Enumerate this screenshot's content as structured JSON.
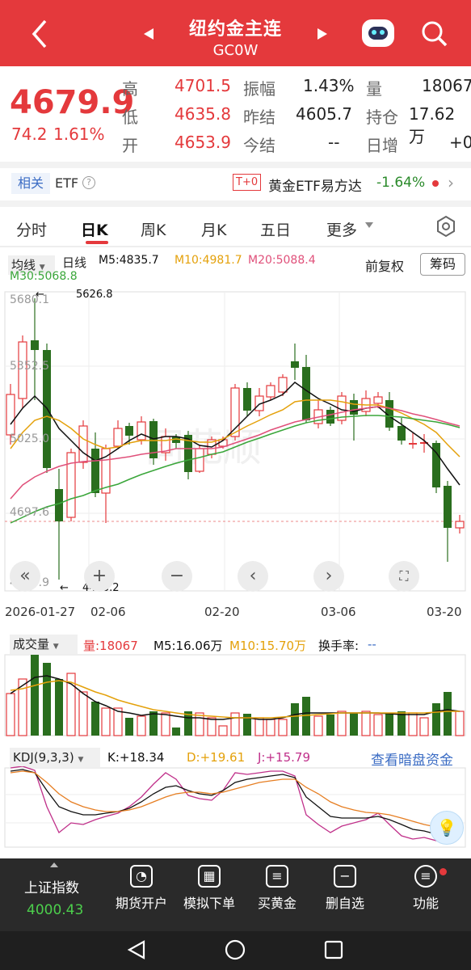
{
  "header": {
    "title": "纽约金主连",
    "code": "GC0W"
  },
  "quote": {
    "price": "4679.9",
    "change": "74.2",
    "change_pct": "1.61%",
    "high_label": "高",
    "high": "4701.5",
    "low_label": "低",
    "low": "4635.8",
    "open_label": "开",
    "open": "4653.9",
    "amp_label": "振幅",
    "amp": "1.43%",
    "prev_label": "昨结",
    "prev": "4605.7",
    "today_label": "今结",
    "today": "--",
    "vol_label": "量",
    "vol": "18067",
    "oi_label": "持仓",
    "oi": "17.62万",
    "inc_label": "日增",
    "inc": "+0"
  },
  "etf": {
    "tag": "相关",
    "name": "ETF",
    "t0": "T+0",
    "fund": "黄金ETF易方达",
    "fund_change": "-1.64%"
  },
  "tabs": [
    "分时",
    "日K",
    "周K",
    "月K",
    "五日",
    "更多"
  ],
  "kline": {
    "ma_select": "均线",
    "period": "日线",
    "m5": "M5:4835.7",
    "m10": "M10:4981.7",
    "m20": "M20:5088.4",
    "m30": "M30:5068.8",
    "adjust": "前复权",
    "chip": "筹码",
    "axis_top": "5680.1",
    "axis_2": "5352.5",
    "axis_3": "5025.0",
    "axis_4": "4697.6",
    "axis_bottom": "4369.9",
    "hi_mark": "5626.8",
    "lo_mark": "4423.2",
    "dates": [
      "2026-01-27",
      "02-06",
      "02-20",
      "03-06",
      "03-20"
    ]
  },
  "volume": {
    "select": "成交量",
    "v": "量:18067",
    "m5": "M5:16.06万",
    "m10": "M10:15.70万",
    "turnover": "换手率:",
    "turnover_val": "--"
  },
  "kdj": {
    "select": "KDJ(9,3,3)",
    "k": "K:+18.34",
    "d": "D:+19.61",
    "j": "J:+15.79",
    "link": "查看暗盘资金"
  },
  "bottom": {
    "index_name": "上证指数",
    "index_val": "4000.43",
    "items": [
      "期货开户",
      "模拟下单",
      "买黄金",
      "删自选",
      "功能"
    ]
  },
  "chart_data": {
    "type": "candlestick",
    "y_ticks": [
      5680.1,
      5352.5,
      5025.0,
      4697.6,
      4369.9
    ],
    "x_ticks": [
      "2026-01-27",
      "02-06",
      "02-20",
      "03-06",
      "03-20"
    ],
    "high_marker": 5626.8,
    "low_marker": 4423.2,
    "volume": {
      "last": 18067,
      "m5": "16.06万",
      "m10": "15.70万"
    },
    "kdj": {
      "k": 18.34,
      "d": 19.61,
      "j": 15.79
    }
  }
}
